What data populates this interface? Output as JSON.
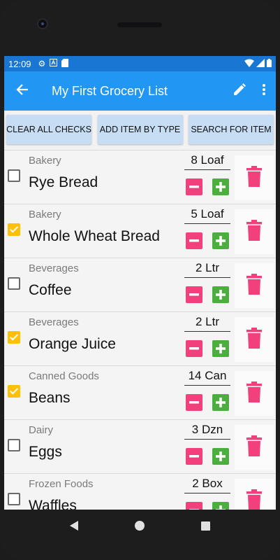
{
  "status": {
    "time": "12:09"
  },
  "appbar": {
    "title": "My First Grocery List"
  },
  "buttons": {
    "clear": "CLEAR ALL CHECKS",
    "add_type": "ADD ITEM BY TYPE",
    "search": "SEARCH FOR ITEM"
  },
  "items": [
    {
      "category": "Bakery",
      "name": "Rye Bread",
      "qty": "8 Loaf",
      "checked": false
    },
    {
      "category": "Bakery",
      "name": "Whole Wheat Bread",
      "qty": "5 Loaf",
      "checked": true
    },
    {
      "category": "Beverages",
      "name": "Coffee",
      "qty": "2 Ltr",
      "checked": false
    },
    {
      "category": "Beverages",
      "name": "Orange Juice",
      "qty": "2 Ltr",
      "checked": true
    },
    {
      "category": "Canned Goods",
      "name": "Beans",
      "qty": "14 Can",
      "checked": true
    },
    {
      "category": "Dairy",
      "name": "Eggs",
      "qty": "3 Dzn",
      "checked": false
    },
    {
      "category": "Frozen Foods",
      "name": "Waffles",
      "qty": "2 Box",
      "checked": false
    }
  ],
  "colors": {
    "statusbar": "#1976d2",
    "appbar": "#2196f3",
    "accent_check": "#ffc107",
    "minus": "#f1407c",
    "plus": "#4cae3e",
    "trash": "#f1407c"
  }
}
